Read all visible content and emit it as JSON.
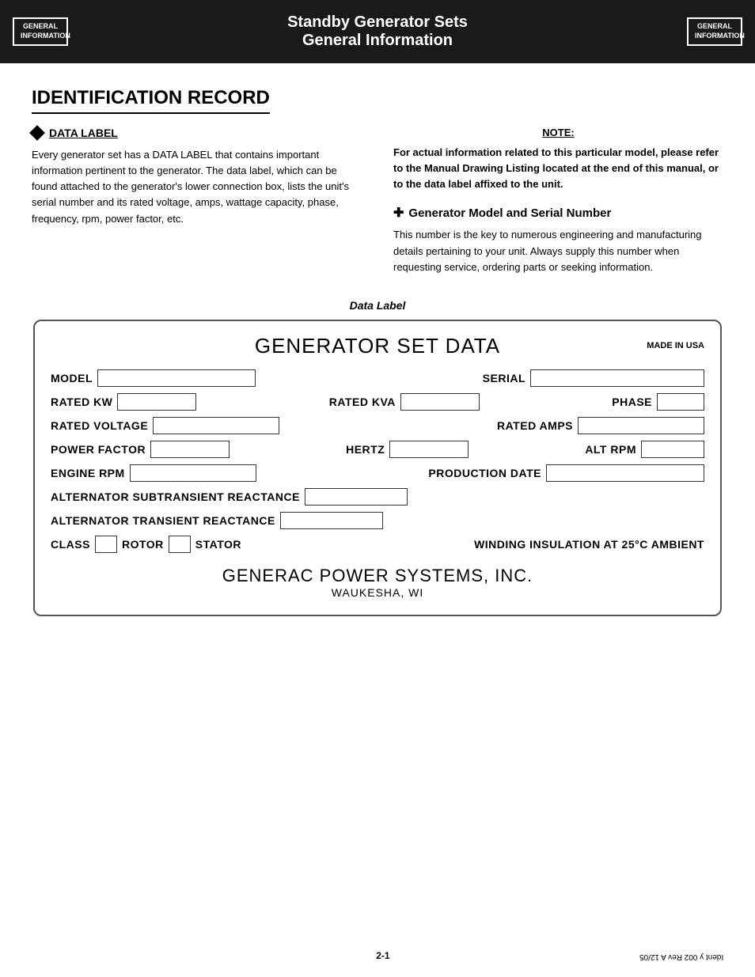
{
  "header": {
    "logo_line1": "GENERAL",
    "logo_line2": "INFORMATION",
    "title_line1": "Standby Generator Sets",
    "title_line2": "General Information"
  },
  "page": {
    "title": "IDENTIFICATION RECORD",
    "data_label_section": {
      "heading": "DATA LABEL",
      "body": "Every generator set has a DATA LABEL that contains important information pertinent to the generator. The data label, which can be found attached to the generator's lower connection box, lists the unit's serial number and its rated voltage, amps, wattage capacity, phase, frequency, rpm, power factor, etc."
    },
    "note_section": {
      "heading": "NOTE:",
      "body": "For actual information related to this particular model, please refer to the Manual Drawing Listing located at the end of this manual, or to the data label affixed to the unit.",
      "gen_model_heading": "Generator Model and Serial Number",
      "gen_model_body": "This number is the key to numerous engineering and manufacturing details pertaining to your unit. Always supply this number when requesting service, ordering parts or seeking information."
    },
    "data_label_caption": "Data Label",
    "data_label_form": {
      "main_title": "GENERATOR SET DATA",
      "made_in_usa": "MADE IN USA",
      "fields": {
        "model_label": "MODEL",
        "serial_label": "SERIAL",
        "rated_kw_label": "RATED KW",
        "rated_kva_label": "RATED KVA",
        "phase_label": "PHASE",
        "rated_voltage_label": "RATED VOLTAGE",
        "rated_amps_label": "RATED AMPS",
        "power_factor_label": "POWER FACTOR",
        "hertz_label": "HERTZ",
        "alt_rpm_label": "ALT RPM",
        "engine_rpm_label": "ENGINE RPM",
        "production_date_label": "PRODUCTION DATE",
        "alt_subtrans_label": "ALTERNATOR SUBTRANSIENT REACTANCE",
        "alt_trans_label": "ALTERNATOR TRANSIENT REACTANCE",
        "class_label": "CLASS",
        "rotor_label": "ROTOR",
        "stator_label": "STATOR",
        "winding_label": "WINDING INSULATION AT 25°C AMBIENT"
      },
      "company_name": "GENERAC POWER SYSTEMS, INC.",
      "company_location": "WAUKESHA, WI"
    }
  },
  "footer": {
    "page_number": "2-1",
    "doc_id": "Ident y 002  Rev  A  12/05"
  }
}
